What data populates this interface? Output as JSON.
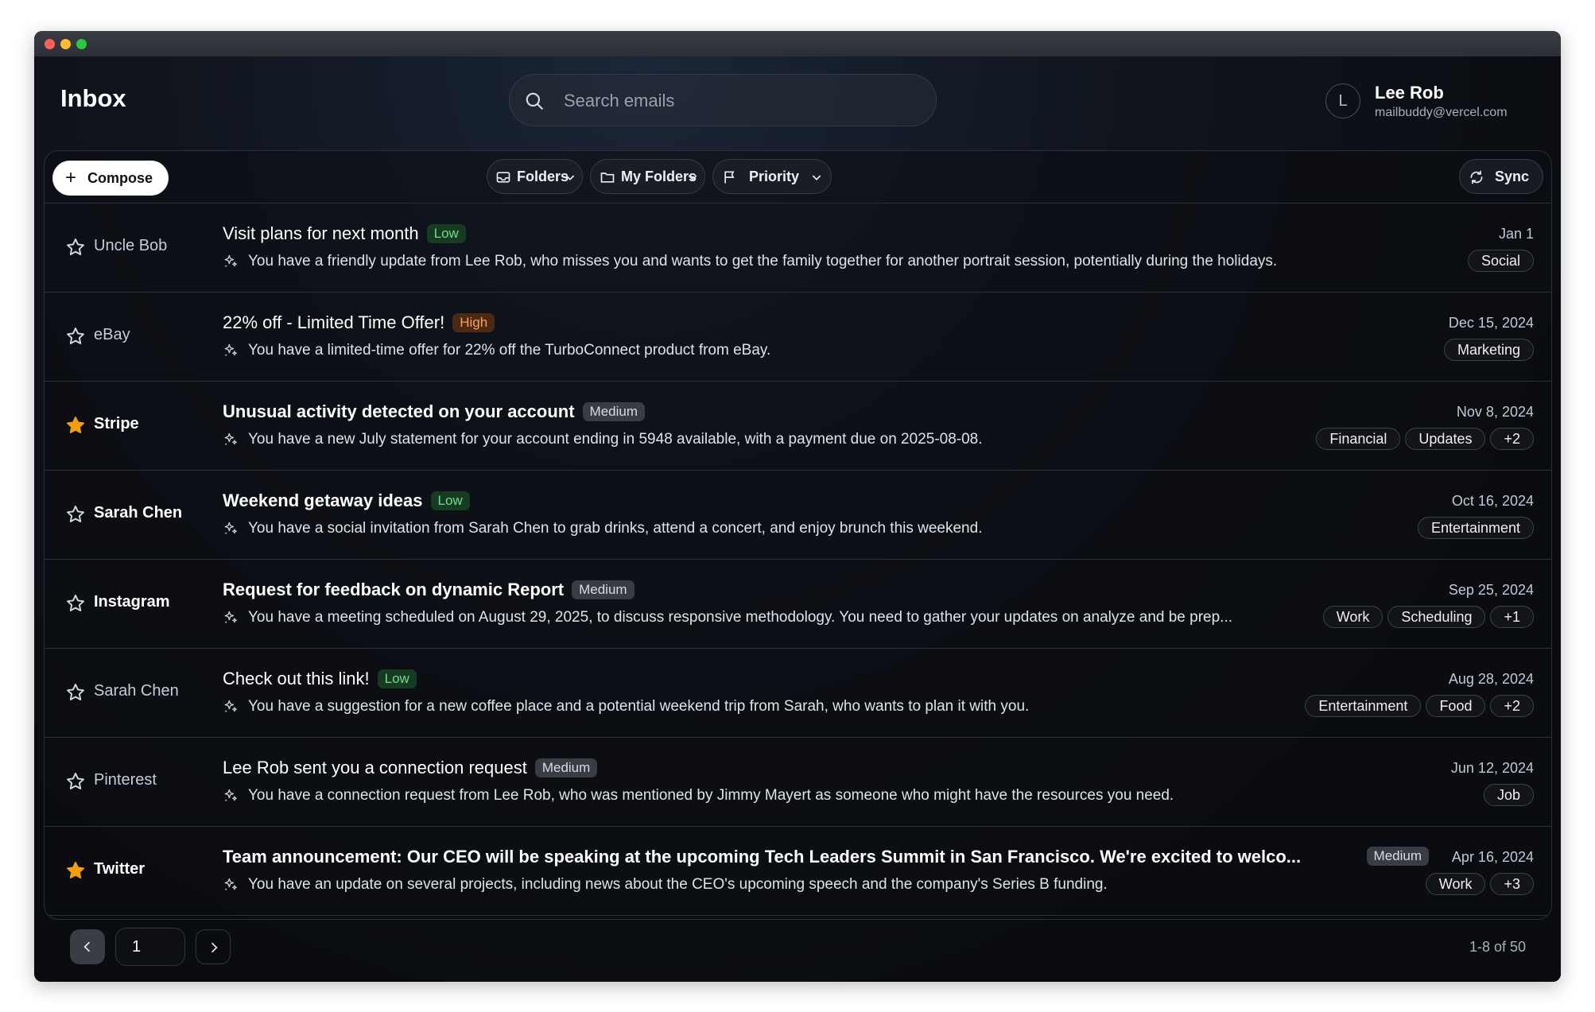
{
  "header": {
    "title": "Inbox",
    "search_placeholder": "Search emails",
    "user": {
      "initial": "L",
      "name": "Lee Rob",
      "email": "mailbuddy@vercel.com"
    }
  },
  "toolbar": {
    "compose_label": "Compose",
    "folders_label": "Folders",
    "my_folders_label": "My Folders",
    "priority_label": "Priority",
    "sync_label": "Sync"
  },
  "emails": [
    {
      "sender": "Uncle Bob",
      "starred": false,
      "unread": false,
      "subject": "Visit plans for next month",
      "priority": "Low",
      "summary": "You have a friendly update from Lee Rob, who misses you and wants to get the family together for another portrait session, potentially during the holidays.",
      "date": "Jan 1",
      "tags": [
        "Social"
      ]
    },
    {
      "sender": "eBay",
      "starred": false,
      "unread": false,
      "subject": "22% off - Limited Time Offer!",
      "priority": "High",
      "summary": "You have a limited-time offer for 22% off the TurboConnect product from eBay.",
      "date": "Dec 15, 2024",
      "tags": [
        "Marketing"
      ]
    },
    {
      "sender": "Stripe",
      "starred": true,
      "unread": true,
      "subject": "Unusual activity detected on your account",
      "priority": "Medium",
      "summary": "You have a new July statement for your account ending in 5948 available, with a payment due on 2025-08-08.",
      "date": "Nov 8, 2024",
      "tags": [
        "Financial",
        "Updates",
        "+2"
      ]
    },
    {
      "sender": "Sarah Chen",
      "starred": false,
      "unread": true,
      "subject": "Weekend getaway ideas",
      "priority": "Low",
      "summary": "You have a social invitation from Sarah Chen to grab drinks, attend a concert, and enjoy brunch this weekend.",
      "date": "Oct 16, 2024",
      "tags": [
        "Entertainment"
      ]
    },
    {
      "sender": "Instagram",
      "starred": false,
      "unread": true,
      "subject": "Request for feedback on dynamic Report",
      "priority": "Medium",
      "summary": "You have a meeting scheduled on August 29, 2025, to discuss responsive methodology. You need to gather your updates on analyze and be prep...",
      "date": "Sep 25, 2024",
      "tags": [
        "Work",
        "Scheduling",
        "+1"
      ]
    },
    {
      "sender": "Sarah Chen",
      "starred": false,
      "unread": false,
      "subject": "Check out this link!",
      "priority": "Low",
      "summary": "You have a suggestion for a new coffee place and a potential weekend trip from Sarah, who wants to plan it with you.",
      "date": "Aug 28, 2024",
      "tags": [
        "Entertainment",
        "Food",
        "+2"
      ]
    },
    {
      "sender": "Pinterest",
      "starred": false,
      "unread": false,
      "subject": "Lee Rob sent you a connection request",
      "priority": "Medium",
      "summary": "You have a connection request from Lee Rob, who was mentioned by Jimmy Mayert as someone who might have the resources you need.",
      "date": "Jun 12, 2024",
      "tags": [
        "Job"
      ]
    },
    {
      "sender": "Twitter",
      "starred": true,
      "unread": true,
      "subject": "Team announcement: Our CEO will be speaking at the upcoming Tech Leaders Summit in San Francisco. We're excited to welco...",
      "priority": "Medium",
      "summary": "You have an update on several projects, including news about the CEO's upcoming speech and the company's Series B funding.",
      "date": "Apr 16, 2024",
      "tags": [
        "Work",
        "+3"
      ]
    }
  ],
  "pagination": {
    "page": "1",
    "range": "1-8 of 50"
  },
  "colors": {
    "star_active": "#f59e0b",
    "low": "#6fdc8c",
    "high": "#fba15a"
  }
}
